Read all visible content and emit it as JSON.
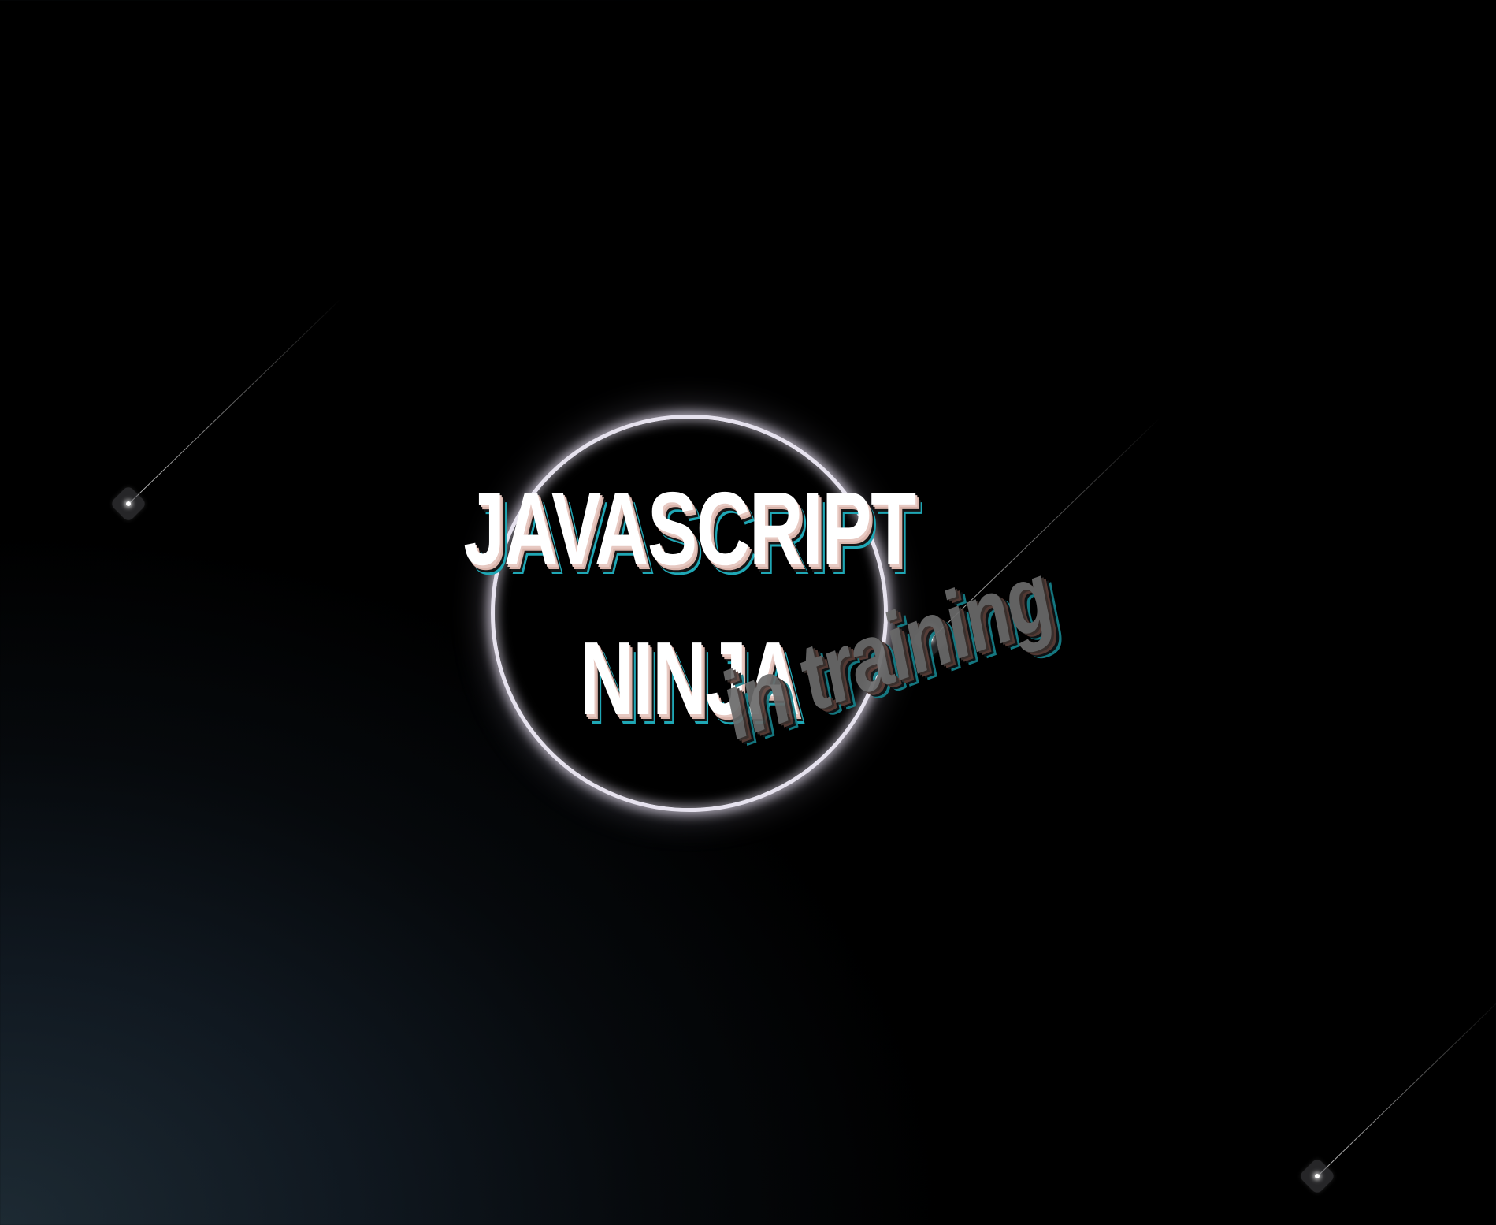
{
  "title": {
    "line1": "JAVASCRIPT",
    "line2": "NINJA",
    "subtitle": "in training"
  },
  "colors": {
    "text": "#ffffff",
    "subtitle": "#6b6b6b",
    "shadow_pink": "#d9b4ab",
    "shadow_teal": "#1fa7b5",
    "ring": "#e6e2ee",
    "background_dark": "#000000",
    "background_light": "#1d2a33"
  },
  "decorations": {
    "glow_ring": "circle-ring",
    "shooting_stars": [
      "shooting-star",
      "shooting-star",
      "shooting-star"
    ]
  }
}
